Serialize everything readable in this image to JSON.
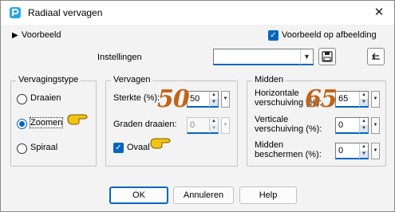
{
  "window": {
    "title": "Radiaal vervagen"
  },
  "top": {
    "preview_toggle_label": "Voorbeeld",
    "preview_on_image_label": "Voorbeeld op afbeelding",
    "preview_on_image_checked": true,
    "settings_label": "Instellingen",
    "settings_value": ""
  },
  "blur_type": {
    "title": "Vervagingstype",
    "options": [
      {
        "label": "Draaien",
        "selected": false
      },
      {
        "label": "Zoomen",
        "selected": true
      },
      {
        "label": "Spiraal",
        "selected": false
      }
    ]
  },
  "blur": {
    "title": "Vervagen",
    "strength_label": "Sterkte (%):",
    "strength_value": "50",
    "rotation_label": "Graden draaien:",
    "rotation_value": "0",
    "oval_label": "Ovaal",
    "oval_checked": true
  },
  "center": {
    "title": "Midden",
    "h_offset_label_1": "Horizontale",
    "h_offset_label_2": "verschuiving (%):",
    "h_offset_value": "65",
    "v_offset_label_1": "Verticale",
    "v_offset_label_2": "verschuiving (%):",
    "v_offset_value": "0",
    "protect_label_1": "Midden",
    "protect_label_2": "beschermen (%):",
    "protect_value": "0"
  },
  "annotations": {
    "strength_overlay": "50",
    "h_offset_overlay": "65"
  },
  "buttons": {
    "ok": "OK",
    "cancel": "Annuleren",
    "help": "Help"
  },
  "colors": {
    "accent": "#0067c0",
    "overlay": "#c06418",
    "hand": "#f1c40f"
  }
}
